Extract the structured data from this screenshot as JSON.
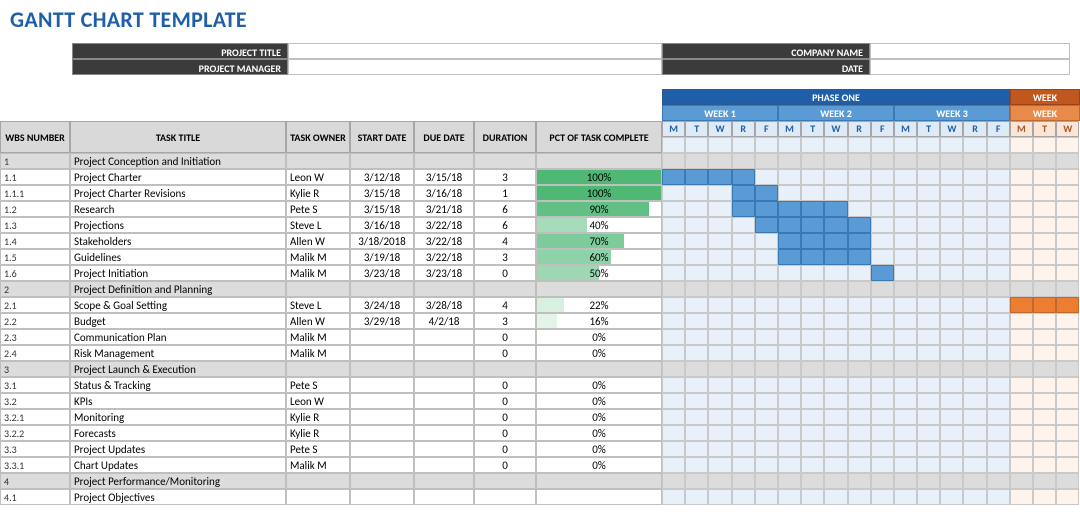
{
  "page_title": "GANTT CHART TEMPLATE",
  "meta": {
    "project_title_label": "PROJECT TITLE",
    "company_name_label": "COMPANY NAME",
    "project_manager_label": "PROJECT MANAGER",
    "date_label": "DATE"
  },
  "phase": {
    "one": "PHASE ONE",
    "two": "WEEK"
  },
  "weeks": {
    "w1": "WEEK 1",
    "w2": "WEEK 2",
    "w3": "WEEK 3",
    "w4": "WEEK"
  },
  "day_labels": [
    "M",
    "T",
    "W",
    "R",
    "F",
    "M",
    "T",
    "W",
    "R",
    "F",
    "M",
    "T",
    "W",
    "R",
    "F",
    "M",
    "T",
    "W"
  ],
  "columns": {
    "wbs": "WBS NUMBER",
    "title": "TASK TITLE",
    "owner": "TASK OWNER",
    "start": "START DATE",
    "due": "DUE DATE",
    "duration": "DURATION",
    "pct": "PCT OF TASK COMPLETE"
  },
  "rows": [
    {
      "kind": "section",
      "wbs": "1",
      "title": "Project Conception and Initiation"
    },
    {
      "kind": "task",
      "wbs": "1.1",
      "title": "Project Charter",
      "owner": "Leon W",
      "start": "3/12/18",
      "due": "3/15/18",
      "duration": "3",
      "pct": "100%",
      "pct_w": 100,
      "pct_c": "#4fb874",
      "bar_start": 0,
      "bar_len": 4,
      "phase": 1
    },
    {
      "kind": "task",
      "wbs": "1.1.1",
      "title": "Project Charter Revisions",
      "owner": "Kylie R",
      "start": "3/15/18",
      "due": "3/16/18",
      "duration": "1",
      "pct": "100%",
      "pct_w": 100,
      "pct_c": "#4fb874",
      "bar_start": 3,
      "bar_len": 2,
      "phase": 1
    },
    {
      "kind": "task",
      "wbs": "1.2",
      "title": "Research",
      "owner": "Pete S",
      "start": "3/15/18",
      "due": "3/21/18",
      "duration": "6",
      "pct": "90%",
      "pct_w": 90,
      "pct_c": "#63c085",
      "bar_start": 3,
      "bar_len": 5,
      "phase": 1
    },
    {
      "kind": "task",
      "wbs": "1.3",
      "title": "Projections",
      "owner": "Steve L",
      "start": "3/16/18",
      "due": "3/22/18",
      "duration": "6",
      "pct": "40%",
      "pct_w": 40,
      "pct_c": "#a7dcba",
      "bar_start": 4,
      "bar_len": 5,
      "phase": 1
    },
    {
      "kind": "task",
      "wbs": "1.4",
      "title": "Stakeholders",
      "owner": "Allen W",
      "start": "3/18/2018",
      "due": "3/22/18",
      "duration": "4",
      "pct": "70%",
      "pct_w": 70,
      "pct_c": "#7dcb9a",
      "bar_start": 5,
      "bar_len": 4,
      "phase": 1
    },
    {
      "kind": "task",
      "wbs": "1.5",
      "title": "Guidelines",
      "owner": "Malik M",
      "start": "3/19/18",
      "due": "3/22/18",
      "duration": "3",
      "pct": "60%",
      "pct_w": 60,
      "pct_c": "#8ed2a7",
      "bar_start": 5,
      "bar_len": 4,
      "phase": 1
    },
    {
      "kind": "task",
      "wbs": "1.6",
      "title": "Project Initiation",
      "owner": "Malik M",
      "start": "3/23/18",
      "due": "3/23/18",
      "duration": "0",
      "pct": "50%",
      "pct_w": 50,
      "pct_c": "#9ed8b3",
      "bar_start": 9,
      "bar_len": 1,
      "phase": 1
    },
    {
      "kind": "section",
      "wbs": "2",
      "title": "Project Definition and Planning"
    },
    {
      "kind": "task",
      "wbs": "2.1",
      "title": "Scope & Goal Setting",
      "owner": "Steve L",
      "start": "3/24/18",
      "due": "3/28/18",
      "duration": "4",
      "pct": "22%",
      "pct_w": 22,
      "pct_c": "#d8f0e0",
      "bar_start": 15,
      "bar_len": 3,
      "phase": 2
    },
    {
      "kind": "task",
      "wbs": "2.2",
      "title": "Budget",
      "owner": "Allen W",
      "start": "3/29/18",
      "due": "4/2/18",
      "duration": "3",
      "pct": "16%",
      "pct_w": 16,
      "pct_c": "#e3f4e9",
      "bar_start": -1,
      "bar_len": 0,
      "phase": 2
    },
    {
      "kind": "task",
      "wbs": "2.3",
      "title": "Communication Plan",
      "owner": "Malik M",
      "start": "",
      "due": "",
      "duration": "0",
      "pct": "0%",
      "pct_w": 0,
      "pct_c": "#ffffff",
      "bar_start": -1,
      "bar_len": 0,
      "phase": 2
    },
    {
      "kind": "task",
      "wbs": "2.4",
      "title": "Risk Management",
      "owner": "Malik M",
      "start": "",
      "due": "",
      "duration": "0",
      "pct": "0%",
      "pct_w": 0,
      "pct_c": "#ffffff",
      "bar_start": -1,
      "bar_len": 0,
      "phase": 2
    },
    {
      "kind": "section",
      "wbs": "3",
      "title": "Project Launch & Execution"
    },
    {
      "kind": "task",
      "wbs": "3.1",
      "title": "Status & Tracking",
      "owner": "Pete S",
      "start": "",
      "due": "",
      "duration": "0",
      "pct": "0%",
      "pct_w": 0,
      "pct_c": "#ffffff",
      "bar_start": -1,
      "bar_len": 0,
      "phase": 2
    },
    {
      "kind": "task",
      "wbs": "3.2",
      "title": "KPIs",
      "owner": "Leon W",
      "start": "",
      "due": "",
      "duration": "0",
      "pct": "0%",
      "pct_w": 0,
      "pct_c": "#ffffff",
      "bar_start": -1,
      "bar_len": 0,
      "phase": 2
    },
    {
      "kind": "task",
      "wbs": "3.2.1",
      "title": "Monitoring",
      "owner": "Kylie R",
      "start": "",
      "due": "",
      "duration": "0",
      "pct": "0%",
      "pct_w": 0,
      "pct_c": "#ffffff",
      "bar_start": -1,
      "bar_len": 0,
      "phase": 2
    },
    {
      "kind": "task",
      "wbs": "3.2.2",
      "title": "Forecasts",
      "owner": "Kylie R",
      "start": "",
      "due": "",
      "duration": "0",
      "pct": "0%",
      "pct_w": 0,
      "pct_c": "#ffffff",
      "bar_start": -1,
      "bar_len": 0,
      "phase": 2
    },
    {
      "kind": "task",
      "wbs": "3.3",
      "title": "Project Updates",
      "owner": "Pete S",
      "start": "",
      "due": "",
      "duration": "0",
      "pct": "0%",
      "pct_w": 0,
      "pct_c": "#ffffff",
      "bar_start": -1,
      "bar_len": 0,
      "phase": 2
    },
    {
      "kind": "task",
      "wbs": "3.3.1",
      "title": "Chart Updates",
      "owner": "Malik M",
      "start": "",
      "due": "",
      "duration": "0",
      "pct": "0%",
      "pct_w": 0,
      "pct_c": "#ffffff",
      "bar_start": -1,
      "bar_len": 0,
      "phase": 2
    },
    {
      "kind": "section",
      "wbs": "4",
      "title": "Project Performance/Monitoring"
    },
    {
      "kind": "task",
      "wbs": "4.1",
      "title": "Project Objectives",
      "owner": "",
      "start": "",
      "due": "",
      "duration": "",
      "pct": "",
      "pct_w": 0,
      "pct_c": "#ffffff",
      "bar_start": -1,
      "bar_len": 0,
      "phase": 2
    }
  ],
  "chart_data": {
    "type": "table",
    "note": "Gantt chart; bar_start is 0-indexed weekday column (M=0) across visible weeks, bar_len is span in weekday cells. phase 1 = blue, phase 2 = orange."
  }
}
